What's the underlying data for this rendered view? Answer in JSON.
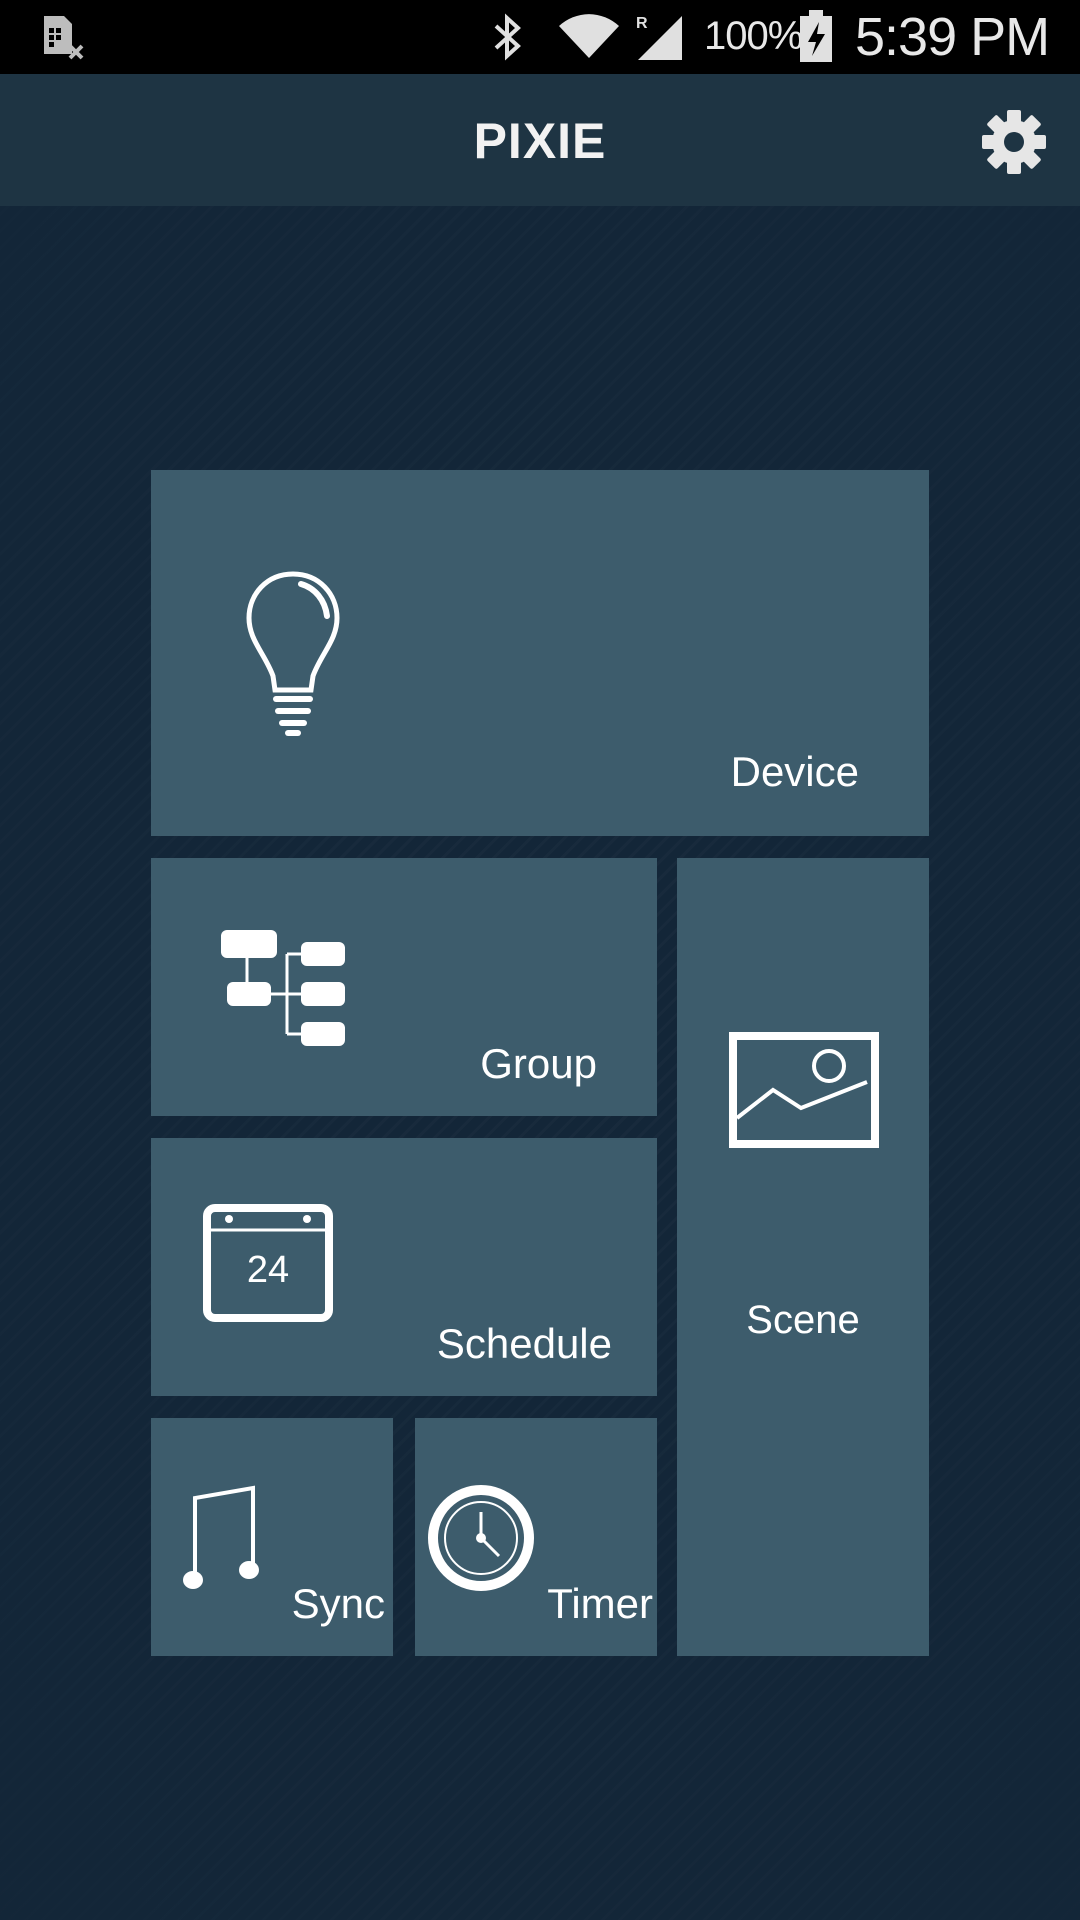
{
  "status_bar": {
    "battery_percent": "100%",
    "time": "5:39 PM",
    "icons": [
      "no-sim-icon",
      "bluetooth-icon",
      "wifi-icon",
      "roaming-signal-icon",
      "battery-charging-icon"
    ]
  },
  "app_bar": {
    "title": "PIXIE",
    "settings_icon": "gear-icon"
  },
  "tiles": {
    "device": {
      "label": "Device",
      "icon": "lightbulb-icon"
    },
    "group": {
      "label": "Group",
      "icon": "hierarchy-icon"
    },
    "schedule": {
      "label": "Schedule",
      "icon": "calendar-icon",
      "calendar_day": "24"
    },
    "sync": {
      "label": "Sync",
      "icon": "music-note-icon"
    },
    "timer": {
      "label": "Timer",
      "icon": "clock-icon"
    },
    "scene": {
      "label": "Scene",
      "icon": "image-icon"
    }
  },
  "colors": {
    "background": "#132638",
    "app_bar": "#1e3443",
    "tile": "#3d5c6c",
    "text": "#ffffff"
  }
}
